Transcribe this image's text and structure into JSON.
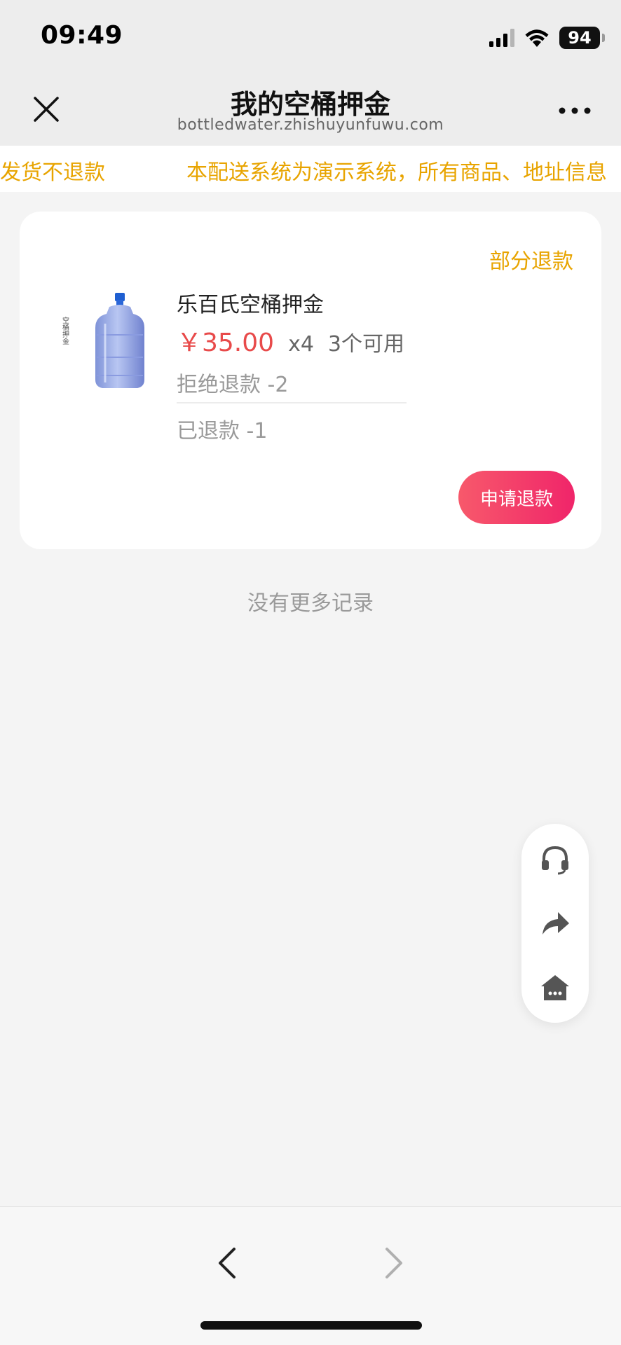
{
  "status_bar": {
    "time": "09:49",
    "battery": "94",
    "icons": [
      "signal-icon",
      "wifi-icon",
      "battery-icon"
    ]
  },
  "nav": {
    "title": "我的空桶押金",
    "url": "bottledwater.zhishuyunfuwu.com",
    "close_icon": "close-icon",
    "more_icon": "more-icon"
  },
  "notice": {
    "text_a": "发货不退款",
    "text_b": "本配送系统为演示系统，所有商品、地址信息"
  },
  "deposit_card": {
    "status": "部分退款",
    "product_name": "乐百氏空桶押金",
    "image_label": "空桶押金",
    "price": "￥35.00",
    "quantity": "x4",
    "available": "3个可用",
    "refused": "拒绝退款 -2",
    "refunded": "已退款 -1",
    "apply_button": "申请退款"
  },
  "list_footer": "没有更多记录",
  "float_tools": [
    "headset-icon",
    "share-icon",
    "home-icon"
  ],
  "browser_nav": [
    "back-icon",
    "forward-icon"
  ],
  "colors": {
    "accent": "#e8a400",
    "price": "#e84a4a",
    "button_start": "#f7596b",
    "button_end": "#f0256a"
  }
}
